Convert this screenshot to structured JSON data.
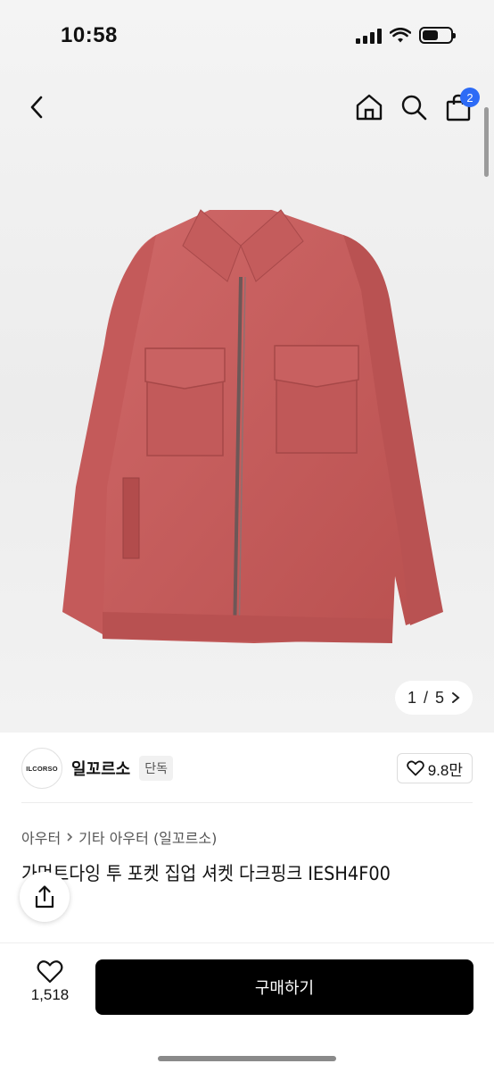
{
  "status_bar": {
    "time": "10:58"
  },
  "nav": {
    "back_icon": "chevron-left-icon",
    "home_icon": "home-icon",
    "search_icon": "search-icon",
    "cart_icon": "shopping-bag-icon",
    "cart_badge": "2"
  },
  "gallery": {
    "current": "1",
    "separator": "/",
    "total": "5"
  },
  "brand": {
    "logo_text": "ILCORSO",
    "name": "일꼬르소",
    "tag": "단독",
    "likes": "9.8만"
  },
  "breadcrumb": {
    "category": "아우터",
    "subcategory": "기타 아우터 (일꼬르소)"
  },
  "product": {
    "title": "가먼트다잉 투 포켓 집업 셔켓 다크핑크 IESH4F00"
  },
  "bottom": {
    "wish_count": "1,518",
    "buy_label": "구매하기"
  },
  "colors": {
    "accent_badge": "#2d6bf6",
    "buy_button": "#000000",
    "jacket": "#c8605f"
  }
}
